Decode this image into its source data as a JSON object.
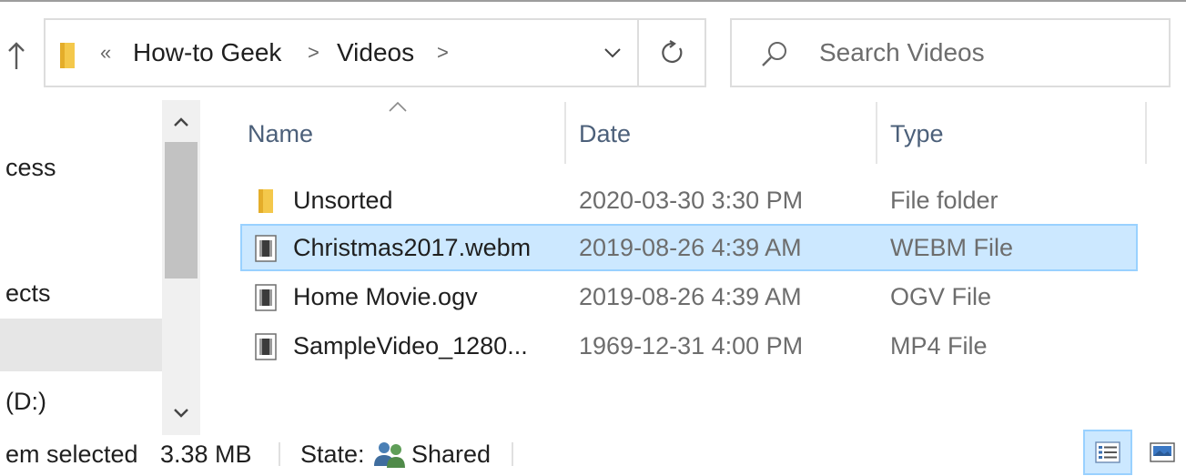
{
  "toolbar": {
    "up_icon": "arrow-up-icon"
  },
  "address_bar": {
    "folder_icon": "folder-icon",
    "overflow_chevron": "«",
    "crumbs": [
      {
        "label": "How-to Geek"
      },
      {
        "label": "Videos"
      }
    ],
    "separator": ">",
    "dropdown_icon": "chevron-down-icon",
    "refresh_icon": "refresh-icon"
  },
  "search": {
    "placeholder": "Search Videos",
    "value": "",
    "icon": "search-icon"
  },
  "navigation": {
    "items": [
      {
        "label": "cess",
        "selected": false
      },
      {
        "label": "ects",
        "selected": false
      },
      {
        "label": "",
        "selected": true
      },
      {
        "label": "(D:)",
        "selected": false
      }
    ]
  },
  "columns": {
    "name": "Name",
    "date": "Date",
    "type": "Type",
    "sort_icon": "sort-ascending-icon"
  },
  "files": [
    {
      "name": "Unsorted",
      "date": "2020-03-30 3:30 PM",
      "type": "File folder",
      "icon": "folder-icon",
      "selected": false
    },
    {
      "name": "Christmas2017.webm",
      "date": "2019-08-26 4:39 AM",
      "type": "WEBM File",
      "icon": "video-file-icon",
      "selected": true
    },
    {
      "name": "Home Movie.ogv",
      "date": "2019-08-26 4:39 AM",
      "type": "OGV File",
      "icon": "video-file-icon",
      "selected": false
    },
    {
      "name": "SampleVideo_1280...",
      "date": "1969-12-31 4:00 PM",
      "type": "MP4 File",
      "icon": "video-file-icon",
      "selected": false
    }
  ],
  "status": {
    "selection": "em selected",
    "size": "3.38 MB",
    "state_label": "State:",
    "state_value": "Shared",
    "state_icon": "shared-users-icon"
  },
  "view_buttons": {
    "details_icon": "details-view-icon",
    "tiles_icon": "large-icons-view-icon",
    "active": "details"
  },
  "colors": {
    "selection_bg": "#cce8ff",
    "selection_border": "#99d1ff",
    "header_text": "#4c607a",
    "secondary_text": "#6d6d6d",
    "folder_yellow": "#f4c84b"
  }
}
